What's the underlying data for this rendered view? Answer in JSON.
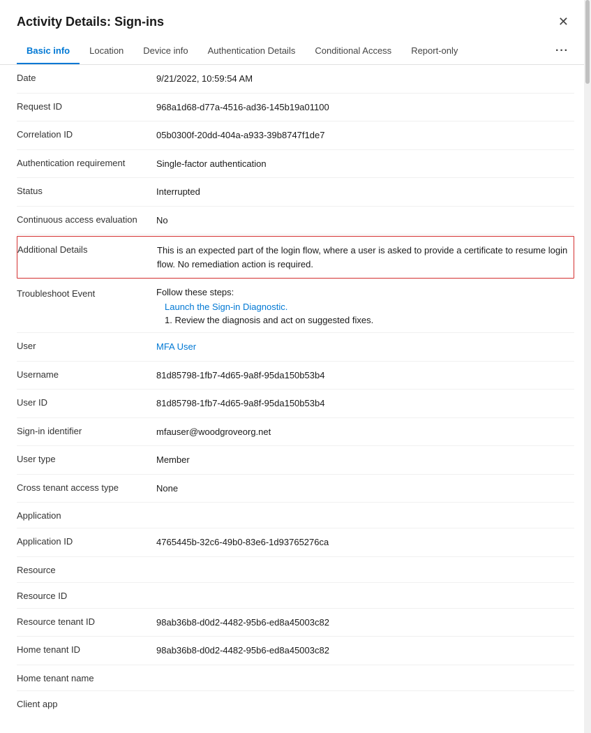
{
  "panel": {
    "title": "Activity Details: Sign-ins"
  },
  "tabs": [
    {
      "id": "basic-info",
      "label": "Basic info",
      "active": true
    },
    {
      "id": "location",
      "label": "Location",
      "active": false
    },
    {
      "id": "device-info",
      "label": "Device info",
      "active": false
    },
    {
      "id": "authentication-details",
      "label": "Authentication Details",
      "active": false
    },
    {
      "id": "conditional-access",
      "label": "Conditional Access",
      "active": false
    },
    {
      "id": "report-only",
      "label": "Report-only",
      "active": false
    }
  ],
  "more_label": "···",
  "close_icon": "✕",
  "rows": [
    {
      "id": "date",
      "label": "Date",
      "value": "9/21/2022, 10:59:54 AM",
      "type": "text",
      "highlighted": false
    },
    {
      "id": "request-id",
      "label": "Request ID",
      "value": "968a1d68-d77a-4516-ad36-145b19a01100",
      "type": "text",
      "highlighted": false
    },
    {
      "id": "correlation-id",
      "label": "Correlation ID",
      "value": "05b0300f-20dd-404a-a933-39b8747f1de7",
      "type": "text",
      "highlighted": false
    },
    {
      "id": "auth-req",
      "label": "Authentication requirement",
      "value": "Single-factor authentication",
      "type": "text",
      "highlighted": false
    },
    {
      "id": "status",
      "label": "Status",
      "value": "Interrupted",
      "type": "text",
      "highlighted": false
    },
    {
      "id": "cae",
      "label": "Continuous access evaluation",
      "value": "No",
      "type": "text",
      "highlighted": false
    },
    {
      "id": "additional-details",
      "label": "Additional Details",
      "value": "This is an expected part of the login flow, where a user is asked to provide a certificate to resume login flow. No remediation action is required.",
      "type": "text",
      "highlighted": true
    }
  ],
  "troubleshoot": {
    "label": "Troubleshoot Event",
    "follow_text": "Follow these steps:",
    "diag_link": "Launch the Sign-in Diagnostic.",
    "steps": [
      "1. Review the diagnosis and act on suggested fixes."
    ]
  },
  "user_rows": [
    {
      "id": "user",
      "label": "User",
      "value": "MFA User",
      "type": "link"
    },
    {
      "id": "username",
      "label": "Username",
      "value": "81d85798-1fb7-4d65-9a8f-95da150b53b4",
      "type": "text"
    },
    {
      "id": "user-id",
      "label": "User ID",
      "value": "81d85798-1fb7-4d65-9a8f-95da150b53b4",
      "type": "text"
    },
    {
      "id": "signin-identifier",
      "label": "Sign-in identifier",
      "value": "mfauser@woodgroveorg.net",
      "type": "text"
    },
    {
      "id": "user-type",
      "label": "User type",
      "value": "Member",
      "type": "text"
    },
    {
      "id": "cross-tenant",
      "label": "Cross tenant access type",
      "value": "None",
      "type": "text"
    },
    {
      "id": "application",
      "label": "Application",
      "value": "",
      "type": "text"
    },
    {
      "id": "application-id",
      "label": "Application ID",
      "value": "4765445b-32c6-49b0-83e6-1d93765276ca",
      "type": "text"
    },
    {
      "id": "resource",
      "label": "Resource",
      "value": "",
      "type": "text"
    },
    {
      "id": "resource-id",
      "label": "Resource ID",
      "value": "",
      "type": "text"
    },
    {
      "id": "resource-tenant-id",
      "label": "Resource tenant ID",
      "value": "98ab36b8-d0d2-4482-95b6-ed8a45003c82",
      "type": "text"
    },
    {
      "id": "home-tenant-id",
      "label": "Home tenant ID",
      "value": "98ab36b8-d0d2-4482-95b6-ed8a45003c82",
      "type": "text"
    },
    {
      "id": "home-tenant-name",
      "label": "Home tenant name",
      "value": "",
      "type": "text"
    },
    {
      "id": "client-app",
      "label": "Client app",
      "value": "",
      "type": "text"
    }
  ]
}
